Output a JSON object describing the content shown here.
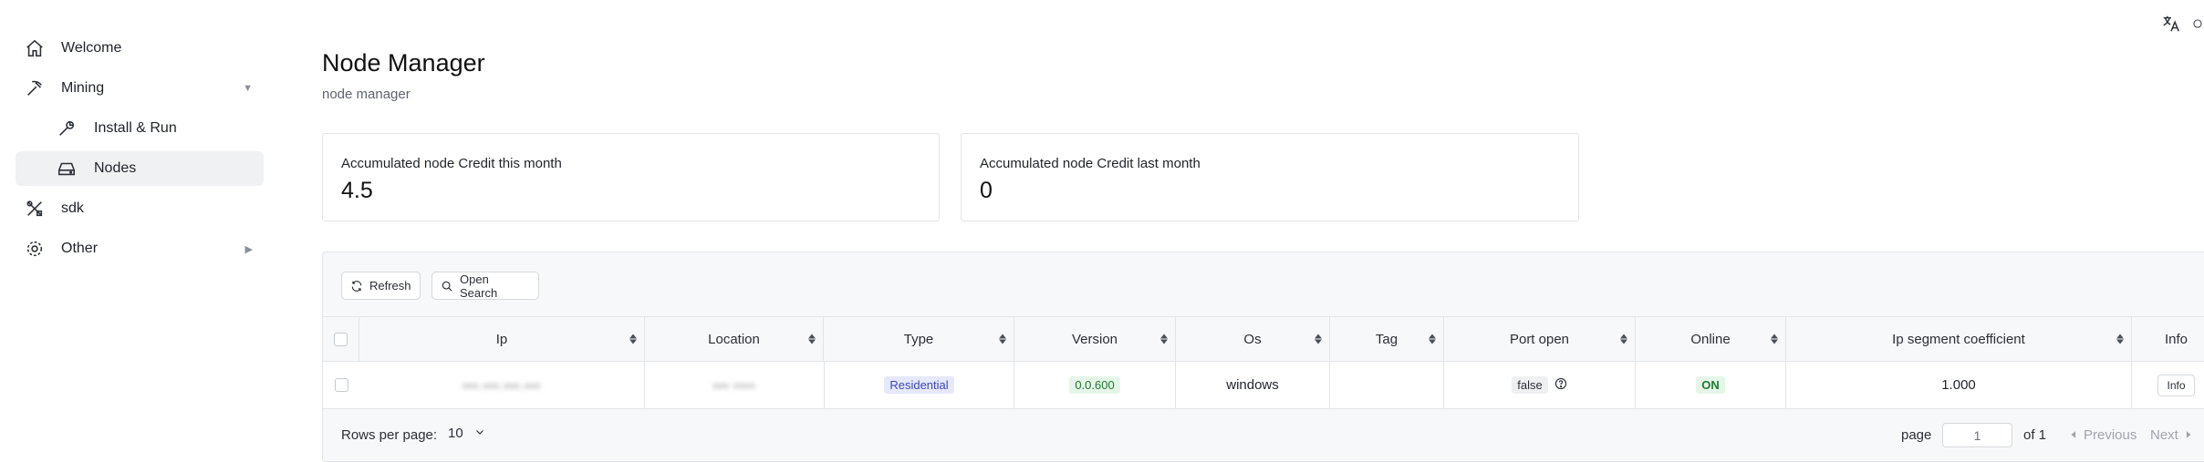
{
  "sidebar": {
    "items": [
      {
        "label": "Welcome",
        "icon": "home-icon"
      },
      {
        "label": "Mining",
        "icon": "pickaxe-icon",
        "caret": "▼"
      },
      {
        "label": "Install & Run",
        "icon": "wrench-icon"
      },
      {
        "label": "Nodes",
        "icon": "drive-icon"
      },
      {
        "label": "sdk",
        "icon": "tools-icon"
      },
      {
        "label": "Other",
        "icon": "gear-icon",
        "caret": "▶"
      }
    ],
    "active_item": "Nodes"
  },
  "header": {
    "title": "Node Manager",
    "subtitle": "node manager"
  },
  "stats": [
    {
      "label": "Accumulated node Credit this month",
      "value": "4.5"
    },
    {
      "label": "Accumulated node Credit last month",
      "value": "0"
    }
  ],
  "toolbar": {
    "refresh_label": "Refresh",
    "open_search_label": "Open Search"
  },
  "table": {
    "columns": [
      "Ip",
      "Location",
      "Type",
      "Version",
      "Os",
      "Tag",
      "Port open",
      "Online",
      "Ip segment coefficient",
      "Info"
    ],
    "rows": [
      {
        "ip": "•••.•••.•••.•••",
        "location": "••• ••••",
        "type": "Residential",
        "version": "0.0.600",
        "os": "windows",
        "tag": "",
        "port_open": "false",
        "online": "ON",
        "ip_segment_coefficient": "1.000",
        "info": "Info"
      }
    ]
  },
  "pagination": {
    "rows_per_page_label": "Rows per page:",
    "rows_per_page_value": "10",
    "page_label": "page",
    "page_value": "1",
    "of_label": "of 1",
    "previous_label": "Previous",
    "next_label": "Next"
  },
  "colors": {
    "active_bg": "#f0f1f3",
    "residential_badge_bg": "#e6e8fb",
    "version_badge_bg": "#e5f6e8",
    "online_badge_fg": "#1e7a33"
  }
}
